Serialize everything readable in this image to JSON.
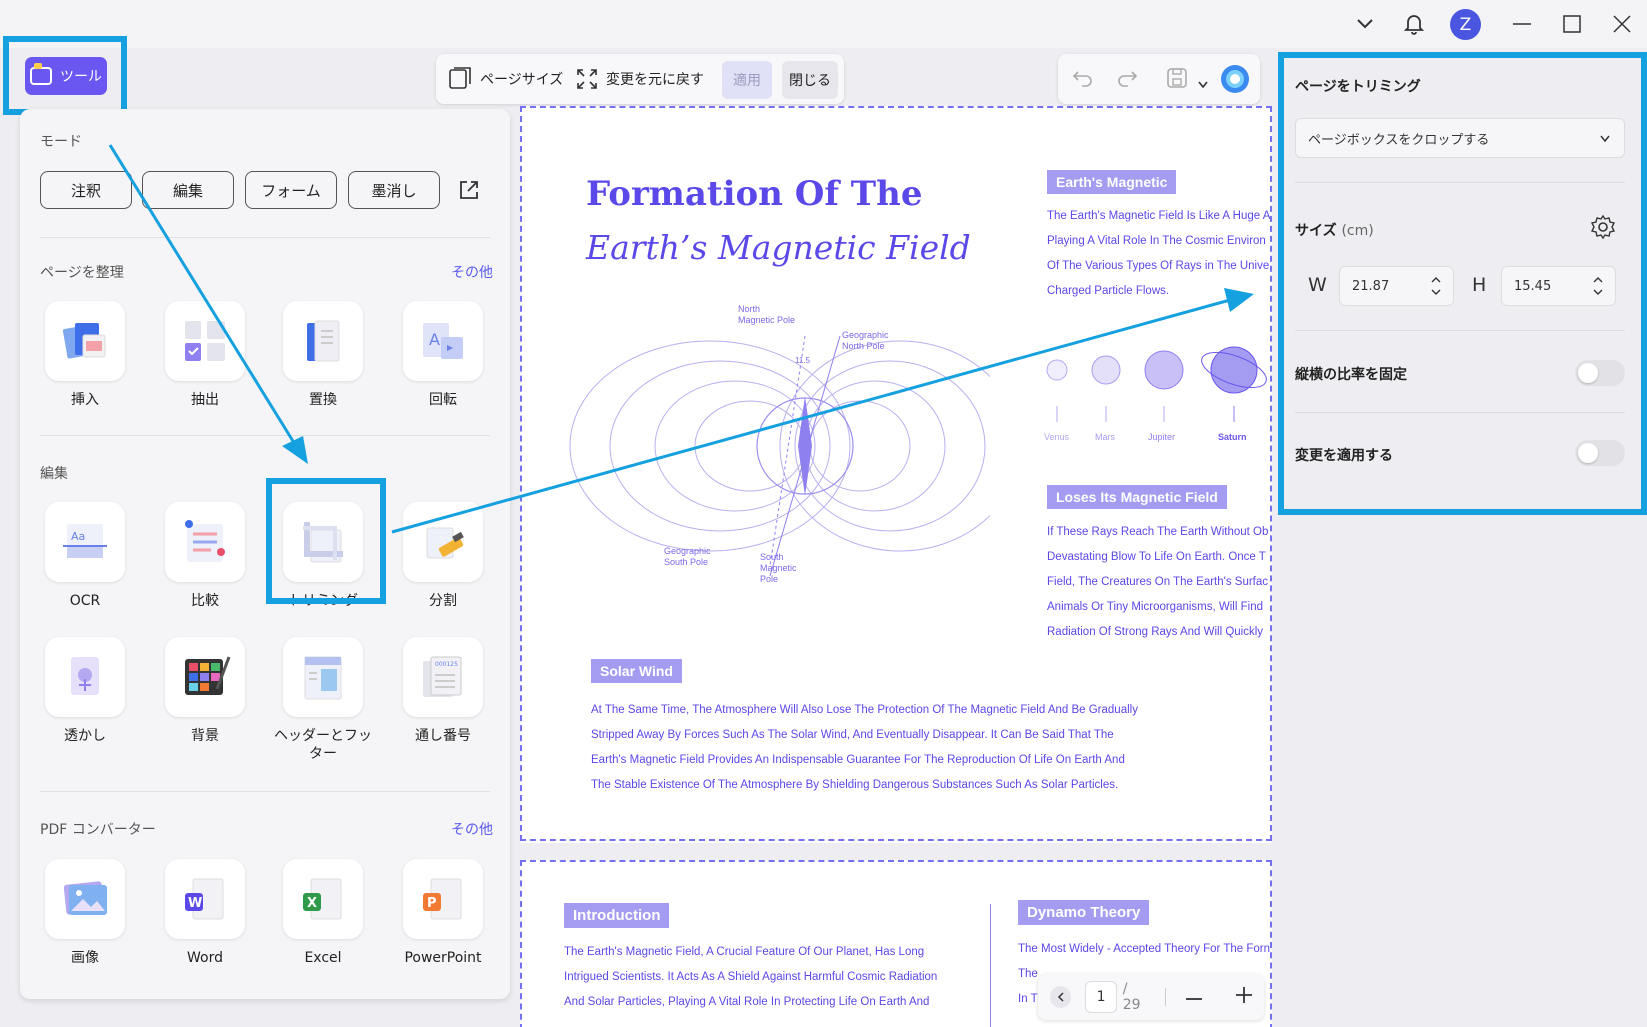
{
  "window": {
    "avatar_letter": "Z"
  },
  "tool_button": {
    "label": "ツール"
  },
  "mode": {
    "label": "モード",
    "buttons": [
      "注釈",
      "編集",
      "フォーム",
      "墨消し"
    ]
  },
  "organize": {
    "label": "ページを整理",
    "more": "その他",
    "items": [
      "挿入",
      "抽出",
      "置換",
      "回転"
    ]
  },
  "edit": {
    "label": "編集",
    "items": [
      "OCR",
      "比較",
      "トリミング",
      "分割",
      "透かし",
      "背景",
      "ヘッダーとフッター",
      "通し番号"
    ]
  },
  "converter": {
    "label": "PDF コンバーター",
    "more": "その他",
    "items": [
      "画像",
      "Word",
      "Excel",
      "PowerPoint"
    ]
  },
  "toolbar": {
    "page_size": "ページサイズ",
    "revert": "変更を元に戻す",
    "apply": "適用",
    "close": "閉じる"
  },
  "document": {
    "title_line1": "Formation Of The",
    "title_line2": "Earth’s Magnetic Field",
    "diagram_labels": {
      "north_magnetic": "North\nMagnetic Pole",
      "geo_north": "Geographic\nNorth Pole",
      "geo_south": "Geographic\nSouth Pole",
      "south_magnetic": "South\nMagnetic\nPole",
      "angle": "11.5"
    },
    "earth_magnetic_heading": "Earth's Magnetic",
    "earth_magnetic_lines": [
      "The Earth's Magnetic Field Is Like A Huge A",
      "Playing A Vital Role In The Cosmic Environ",
      "Of The Various Types Of Rays in The Unive",
      "Charged Particle Flows."
    ],
    "planets": [
      "Venus",
      "Mars",
      "Jupiter",
      "Saturn"
    ],
    "loses_heading": "Loses Its Magnetic Field",
    "loses_lines": [
      "If These Rays Reach The Earth Without Ob",
      "Devastating Blow To Life On Earth. Once T",
      "Field, The Creatures On The Earth's Surfac",
      "Animals Or Tiny Microorganisms, Will Find",
      "Radiation Of Strong Rays And Will Quickly"
    ],
    "solar_heading": "Solar Wind",
    "solar_lines": [
      "At The Same Time, The Atmosphere Will Also Lose The Protection Of The Magnetic Field And Be Gradually",
      "Stripped Away By Forces Such As The Solar Wind, And Eventually Disappear. It Can Be Said That The",
      "Earth's Magnetic Field Provides An Indispensable Guarantee For The Reproduction Of Life On Earth And",
      "The Stable Existence Of The Atmosphere By Shielding Dangerous Substances Such As Solar Particles."
    ],
    "intro_heading": "Introduction",
    "intro_lines": [
      "The Earth's Magnetic Field, A Crucial Feature Of Our Planet, Has Long",
      "Intrigued Scientists. It Acts As A Shield Against Harmful Cosmic Radiation",
      "And Solar Particles, Playing A Vital Role In Protecting Life On Earth And"
    ],
    "dynamo_heading": "Dynamo Theory",
    "dynamo_lines": [
      "The Most Widely - Accepted Theory For The Forn",
      "The",
      "In T"
    ]
  },
  "crop_panel": {
    "title": "ページをトリミング",
    "box_select": "ページボックスをクロップする",
    "size_label": "サイズ",
    "size_unit": "(cm)",
    "w_label": "W",
    "w_value": "21.87",
    "h_label": "H",
    "h_value": "15.45",
    "lock_ratio": "縦横の比率を固定",
    "apply_changes": "変更を適用する"
  },
  "pager": {
    "current": "1",
    "total": "/ 29"
  },
  "colors": {
    "accent": "#6a56f0",
    "highlight": "#15a0e0",
    "doc_text": "#5a48e8"
  }
}
